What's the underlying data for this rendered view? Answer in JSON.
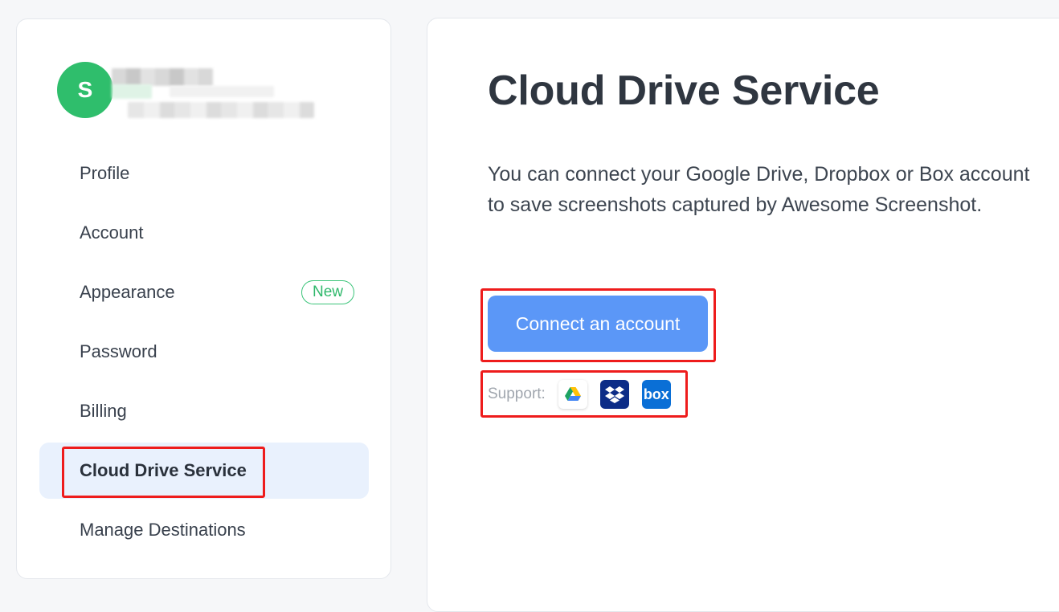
{
  "user": {
    "avatar_initial": "S"
  },
  "sidebar": {
    "items": [
      {
        "label": "Profile"
      },
      {
        "label": "Account"
      },
      {
        "label": "Appearance",
        "badge": "New"
      },
      {
        "label": "Password"
      },
      {
        "label": "Billing"
      },
      {
        "label": "Cloud Drive Service",
        "active": true
      },
      {
        "label": "Manage Destinations"
      }
    ]
  },
  "main": {
    "title": "Cloud Drive Service",
    "description": "You can connect your Google Drive, Dropbox or Box account to save screenshots captured by Awesome Screenshot.",
    "connect_label": "Connect an account",
    "support_label": "Support:",
    "providers": [
      {
        "icon": "google-drive-icon"
      },
      {
        "icon": "dropbox-icon"
      },
      {
        "icon": "box-icon",
        "text": "box"
      }
    ]
  },
  "colors": {
    "accent": "#5b97f7",
    "active_bg": "#e9f1fd",
    "avatar": "#2fbe6c",
    "badge": "#3cc47a",
    "highlight": "#ee1c1c"
  }
}
